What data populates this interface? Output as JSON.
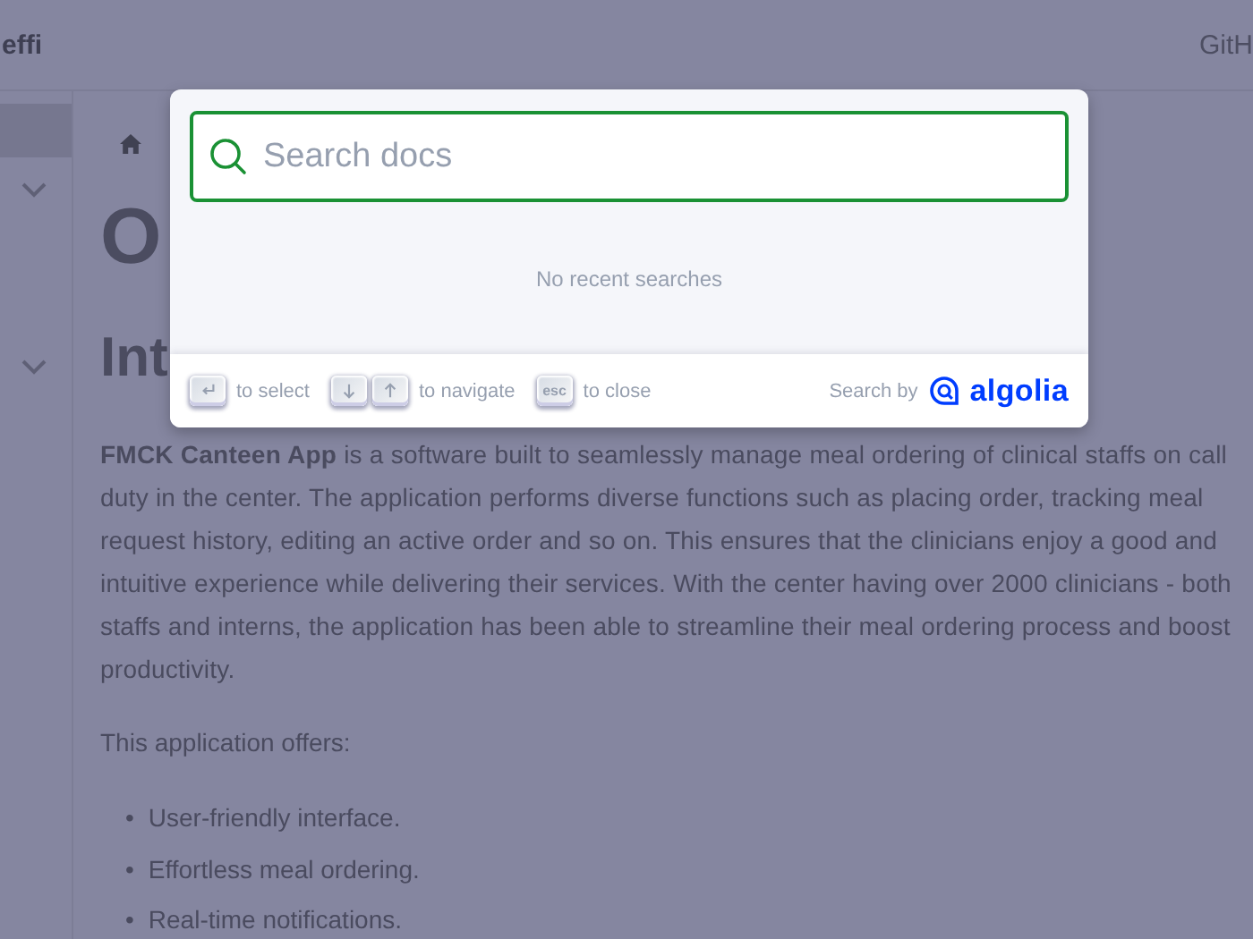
{
  "header": {
    "brand": "effi",
    "link": "GitH"
  },
  "article": {
    "headings": [
      "O",
      "Int"
    ],
    "paragraph": "**FMCK Canteen App** is a software built to seamlessly manage meal ordering of clinical staffs on call duty in the center. The application performs diverse functions such as placing order, tracking meal request history, editing an active order and so on. This ensures that the clinicians enjoy a good and intuitive experience while delivering their services. With the center having over 2000 clinicians - both staffs and interns, the application has been able to streamline their meal ordering process and boost productivity.",
    "intro": "This application offers:",
    "list": [
      {
        "marker": "•",
        "text": "User-friendly interface."
      },
      {
        "marker": "•",
        "text": "Effortless meal ordering."
      },
      {
        "marker": "•",
        "text": "Real-time notifications."
      }
    ]
  },
  "search": {
    "placeholder": "Search docs",
    "empty": "No recent searches",
    "commands": [
      {
        "keys": [
          {
            "kind": "enter"
          }
        ],
        "label": "to select"
      },
      {
        "keys": [
          {
            "kind": "down"
          },
          {
            "kind": "up"
          }
        ],
        "label": "to navigate"
      },
      {
        "keys": [
          {
            "kind": "text",
            "text": "esc"
          }
        ],
        "label": "to close"
      }
    ],
    "search_by": "Search by",
    "logo": "algolia"
  }
}
